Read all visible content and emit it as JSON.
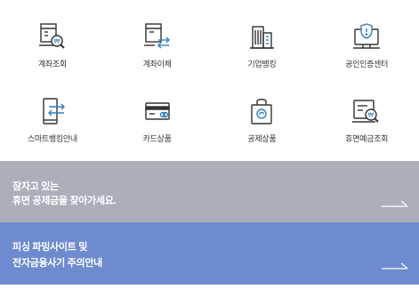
{
  "menu": {
    "items": [
      {
        "label": "계좌조회",
        "icon": "account-inquiry-icon"
      },
      {
        "label": "계좌이체",
        "icon": "account-transfer-icon"
      },
      {
        "label": "기업뱅킹",
        "icon": "corporate-banking-icon"
      },
      {
        "label": "공인인증센터",
        "icon": "certificate-center-icon"
      },
      {
        "label": "스마트뱅킹안내",
        "icon": "smart-banking-icon"
      },
      {
        "label": "카드상품",
        "icon": "card-products-icon"
      },
      {
        "label": "공제상품",
        "icon": "mutual-aid-products-icon"
      },
      {
        "label": "휴면예금조회",
        "icon": "dormant-deposit-icon"
      }
    ]
  },
  "banners": {
    "dormant": {
      "line1": "잠자고 있는",
      "line2": "휴면 공제금을 찾아가세요.",
      "color": "#abb0b8"
    },
    "phishing": {
      "line1": "피싱 파밍사이트 및",
      "line2": "전자금융사기 주의안내",
      "color": "#6e8bd0"
    }
  },
  "colors": {
    "icon_dark": "#333333",
    "icon_accent": "#2e7fc3"
  }
}
